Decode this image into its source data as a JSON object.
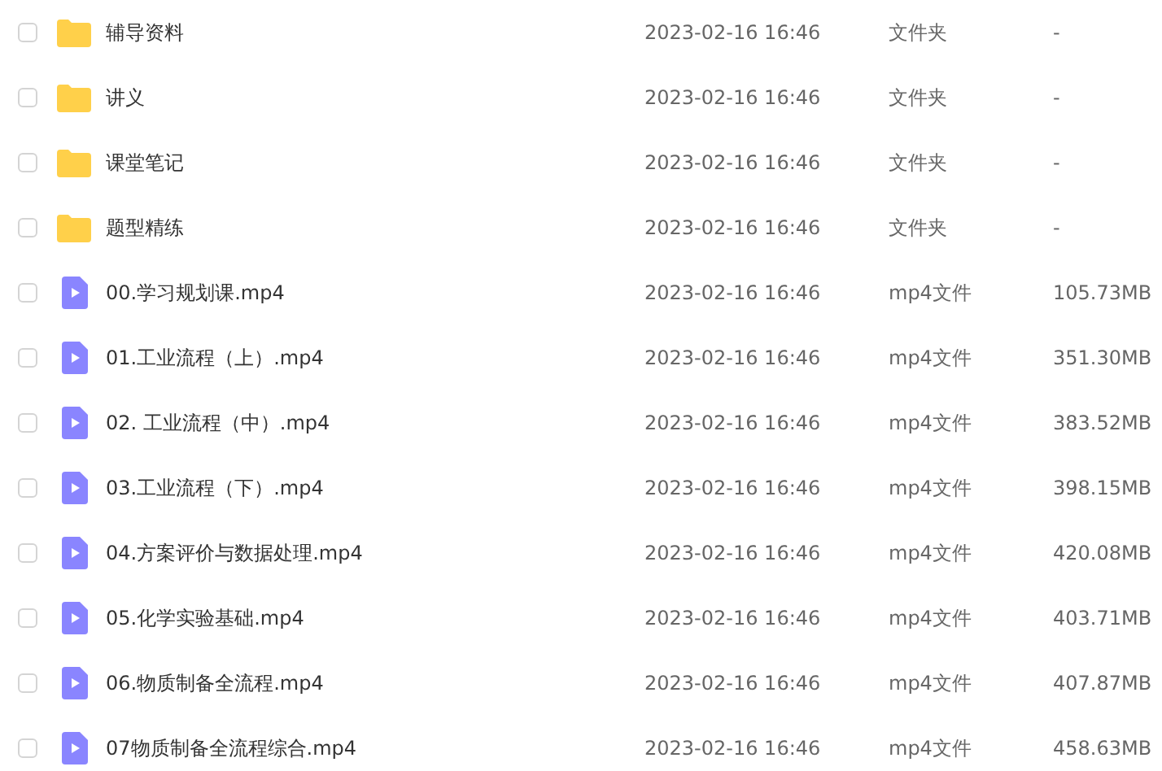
{
  "files": [
    {
      "kind": "folder",
      "name": "辅导资料",
      "modified": "2023-02-16 16:46",
      "type": "文件夹",
      "size": "-",
      "checked": false
    },
    {
      "kind": "folder",
      "name": "讲义",
      "modified": "2023-02-16 16:46",
      "type": "文件夹",
      "size": "-",
      "checked": false
    },
    {
      "kind": "folder",
      "name": "课堂笔记",
      "modified": "2023-02-16 16:46",
      "type": "文件夹",
      "size": "-",
      "checked": false
    },
    {
      "kind": "folder",
      "name": "题型精练",
      "modified": "2023-02-16 16:46",
      "type": "文件夹",
      "size": "-",
      "checked": false
    },
    {
      "kind": "video",
      "name": "00.学习规划课.mp4",
      "modified": "2023-02-16 16:46",
      "type": "mp4文件",
      "size": "105.73MB",
      "checked": false
    },
    {
      "kind": "video",
      "name": "01.工业流程（上）.mp4",
      "modified": "2023-02-16 16:46",
      "type": "mp4文件",
      "size": "351.30MB",
      "checked": false
    },
    {
      "kind": "video",
      "name": "02. 工业流程（中）.mp4",
      "modified": "2023-02-16 16:46",
      "type": "mp4文件",
      "size": "383.52MB",
      "checked": false
    },
    {
      "kind": "video",
      "name": "03.工业流程（下）.mp4",
      "modified": "2023-02-16 16:46",
      "type": "mp4文件",
      "size": "398.15MB",
      "checked": false
    },
    {
      "kind": "video",
      "name": "04.方案评价与数据处理.mp4",
      "modified": "2023-02-16 16:46",
      "type": "mp4文件",
      "size": "420.08MB",
      "checked": false
    },
    {
      "kind": "video",
      "name": "05.化学实验基础.mp4",
      "modified": "2023-02-16 16:46",
      "type": "mp4文件",
      "size": "403.71MB",
      "checked": false
    },
    {
      "kind": "video",
      "name": "06.物质制备全流程.mp4",
      "modified": "2023-02-16 16:46",
      "type": "mp4文件",
      "size": "407.87MB",
      "checked": false
    },
    {
      "kind": "video",
      "name": "07物质制备全流程综合.mp4",
      "modified": "2023-02-16 16:46",
      "type": "mp4文件",
      "size": "458.63MB",
      "checked": false
    }
  ]
}
